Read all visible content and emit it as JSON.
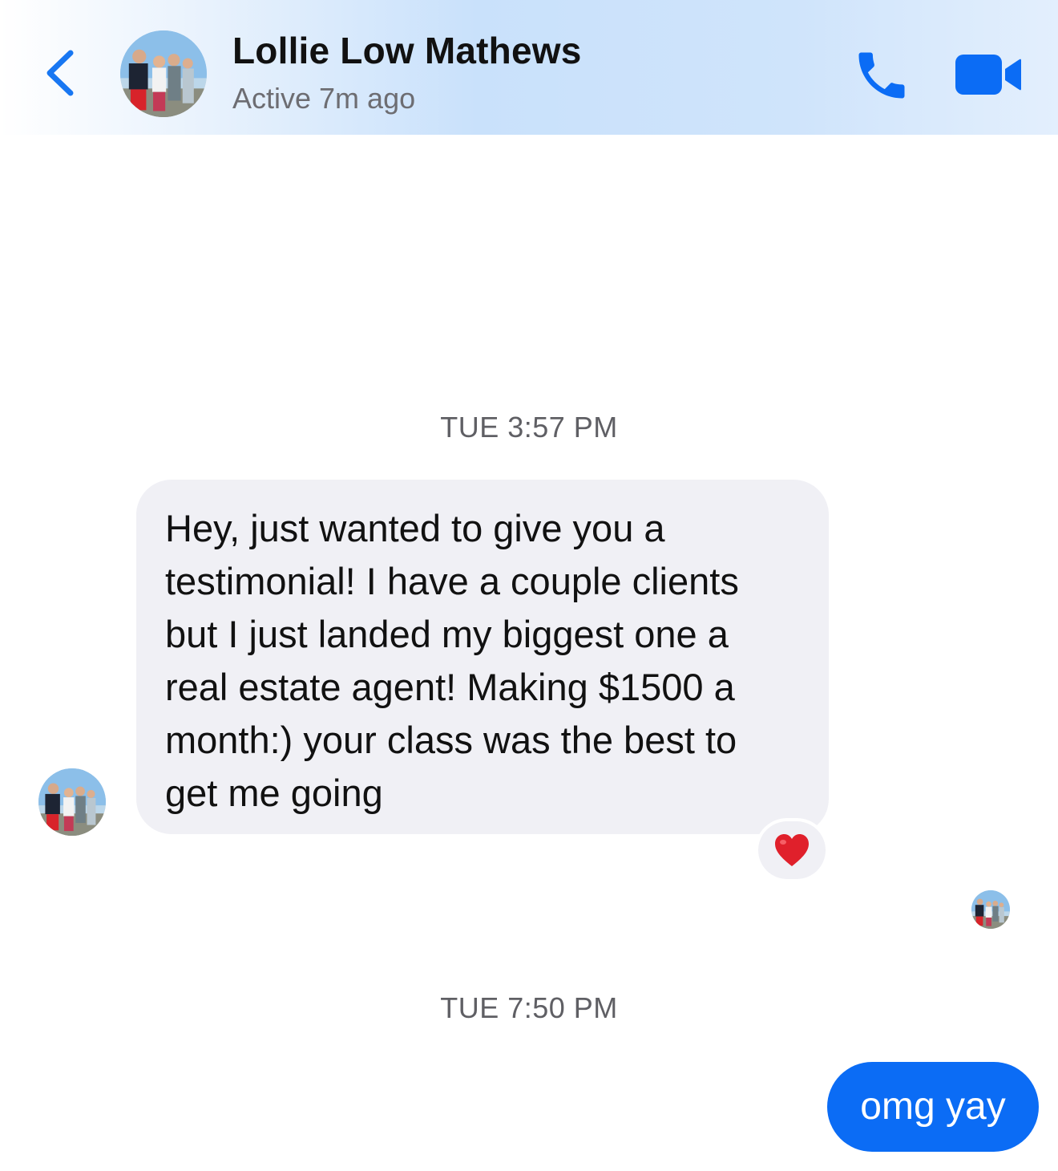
{
  "header": {
    "back_icon": "chevron-left-icon",
    "contact_name": "Lollie Low Mathews",
    "status": "Active 7m ago",
    "call_icon": "phone-icon",
    "video_icon": "video-camera-icon",
    "accent_color": "#0b6cf5"
  },
  "conversation": {
    "timestamps": [
      "TUE 3:57 PM",
      "TUE 7:50 PM"
    ],
    "incoming_message": {
      "lines": [
        "Hey, just wanted to give you a",
        "testimonial! I have a couple clients",
        "but I just landed my biggest one a",
        "real estate agent! Making $1500 a",
        "month:) your class was the best to",
        "get me going"
      ],
      "reaction": "❤️",
      "reaction_icon": "red-heart-icon",
      "bubble_color": "#f0f0f5"
    },
    "outgoing_message": {
      "text": "omg yay",
      "bubble_color": "#0b6cf5"
    }
  }
}
